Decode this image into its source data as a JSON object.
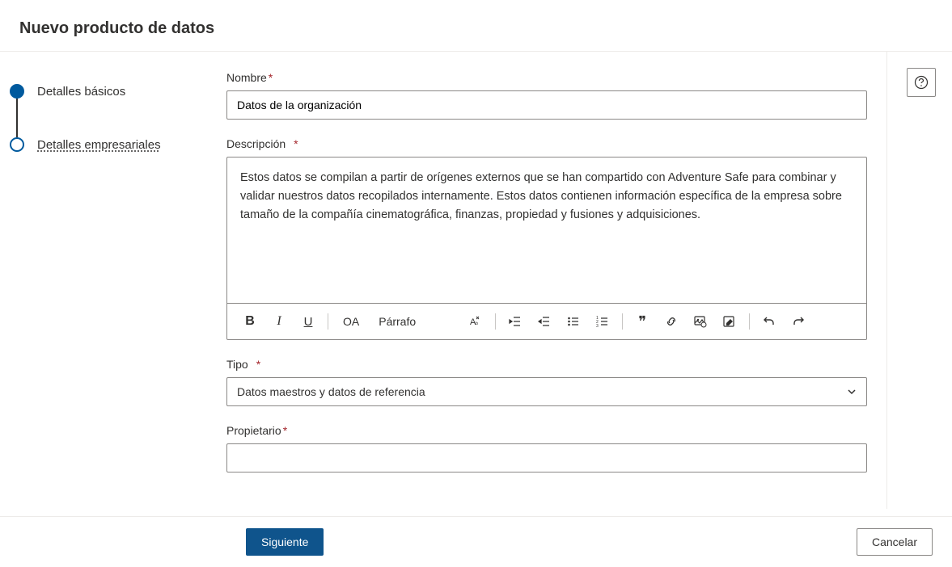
{
  "header": {
    "title": "Nuevo producto de datos"
  },
  "steps": {
    "0": {
      "label": "Detalles básicos"
    },
    "1": {
      "label": "Detalles empresariales"
    }
  },
  "form": {
    "name": {
      "label": "Nombre",
      "value": "Datos de la organización"
    },
    "description": {
      "label": "Descripción",
      "value": "Estos datos se compilan a partir de orígenes externos que se han compartido con Adventure Safe para combinar y validar nuestros datos recopilados internamente.    Estos datos contienen información específica de la empresa sobre tamaño de la compañía cinematográfica, finanzas, propiedad y fusiones y adquisiciones."
    },
    "type": {
      "label": "Tipo",
      "value": "Datos maestros y datos de referencia"
    },
    "owner": {
      "label": "Propietario",
      "value": ""
    },
    "toolbar": {
      "font": "OA",
      "paragraph": "Párrafo"
    }
  },
  "footer": {
    "next": "Siguiente",
    "cancel": "Cancelar"
  }
}
